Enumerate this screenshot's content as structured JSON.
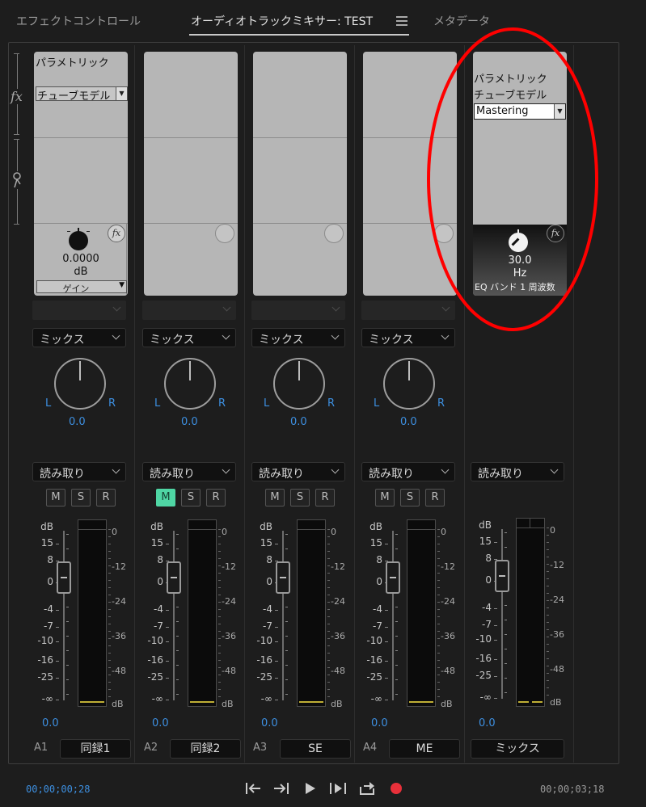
{
  "tabs": [
    {
      "label": "エフェクトコントロール",
      "active": false
    },
    {
      "label": "オーディオトラックミキサー: TEST",
      "active": true
    },
    {
      "label": "メタデータ",
      "active": false
    }
  ],
  "panel_menu_icon": "hamburger-menu-icon",
  "rail": {
    "fx_label": "fx",
    "send_icon": "send-icon"
  },
  "channels": [
    {
      "id": "A1",
      "name": "同録1",
      "effect1": "パラメトリック",
      "effect2": "チューブモデル",
      "param_value": "0.0000",
      "param_unit": "dB",
      "param_name": "ゲイン",
      "mode": "ミックス",
      "pan": "0.0",
      "pan_l": "L",
      "pan_r": "R",
      "automation": "読み取り",
      "m": "M",
      "s": "S",
      "r": "R",
      "mute_on": true,
      "volume": "0.0"
    },
    {
      "id": "A2",
      "name": "同録2",
      "mode": "ミックス",
      "pan": "0.0",
      "pan_l": "L",
      "pan_r": "R",
      "automation": "読み取り",
      "m": "M",
      "s": "S",
      "r": "R",
      "volume": "0.0"
    },
    {
      "id": "A3",
      "name": "SE",
      "mode": "ミックス",
      "pan": "0.0",
      "pan_l": "L",
      "pan_r": "R",
      "automation": "読み取り",
      "m": "M",
      "s": "S",
      "r": "R",
      "volume": "0.0"
    },
    {
      "id": "A4",
      "name": "ME",
      "mode": "ミックス",
      "pan": "0.0",
      "pan_l": "L",
      "pan_r": "R",
      "automation": "読み取り",
      "m": "M",
      "s": "S",
      "r": "R",
      "volume": "0.0"
    }
  ],
  "master": {
    "name": "ミックス",
    "effect1": "パラメトリック",
    "effect2": "チューブモデル",
    "preset": "Mastering",
    "param_value": "30.0",
    "param_unit": "Hz",
    "param_name": "EQ バンド 1 周波数",
    "automation": "読み取り",
    "volume": "0.0"
  },
  "fader_scale": [
    "dB",
    "15",
    "8",
    "0",
    "-4",
    "-7",
    "-10",
    "-16",
    "-25",
    "-∞"
  ],
  "meter_scale": [
    "0",
    "-12",
    "-24",
    "-36",
    "-48",
    "dB"
  ],
  "transport": {
    "timecode_in": "00;00;00;28",
    "timecode_out": "00;00;03;18",
    "buttons": [
      "go-to-in-icon",
      "go-to-out-icon",
      "play-icon",
      "loop-in-out-icon",
      "loop-icon",
      "record-icon"
    ]
  },
  "colors": {
    "accent_blue": "#3d8fe0",
    "mute_green": "#4fd6a4",
    "record_red": "#e8303a",
    "annotation_red": "#ff0000"
  }
}
